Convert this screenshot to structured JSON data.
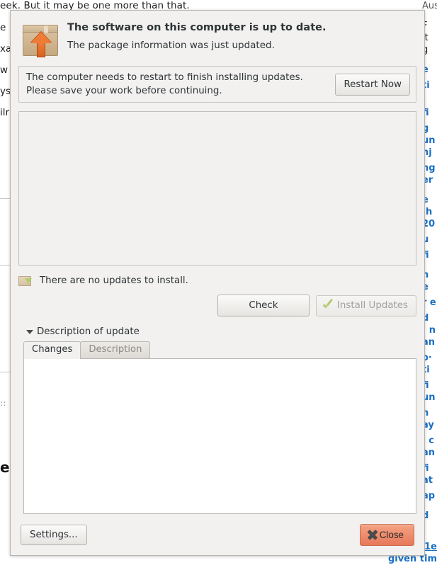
{
  "background": {
    "top_line": "eek. But it may be one more than that.",
    "left_fragments": [
      "e",
      "xa",
      "w",
      "ys",
      "ilr"
    ],
    "left_big_fragment": "e",
    "left_dots": "∷",
    "top_right_fragment": "Austin T",
    "right_fragments": [
      {
        "text": "F",
        "link": false
      },
      {
        "text": "it",
        "link": false
      },
      {
        "text": "g",
        "link": false
      },
      {
        "text": "e",
        "link": true
      },
      {
        "text": "ti",
        "link": true
      },
      {
        "text": "·",
        "link": false
      },
      {
        "text": "fi",
        "link": true
      },
      {
        "text": "g",
        "link": true
      },
      {
        "text": "un",
        "link": true
      },
      {
        "text": "nj",
        "link": true
      },
      {
        "text": "ng",
        "link": true
      },
      {
        "text": "er",
        "link": true
      },
      {
        "text": "e",
        "link": true
      },
      {
        "text": "·h",
        "link": true
      },
      {
        "text": "20",
        "link": true
      },
      {
        "text": "u",
        "link": true
      },
      {
        "text": "fi",
        "link": true
      },
      {
        "text": "n",
        "link": true
      },
      {
        "text": "e",
        "link": true
      },
      {
        "text": "r e",
        "link": true
      },
      {
        "text": "d",
        "link": true
      },
      {
        "text": ": n",
        "link": true
      },
      {
        "text": "an",
        "link": true
      },
      {
        "text": "o·",
        "link": true
      },
      {
        "text": "ti",
        "link": true
      },
      {
        "text": "fi",
        "link": true
      },
      {
        "text": "un",
        "link": true
      },
      {
        "text": "n",
        "link": true
      },
      {
        "text": "ay",
        "link": true
      },
      {
        "text": "| c",
        "link": true
      },
      {
        "text": "an",
        "link": true
      },
      {
        "text": "fi",
        "link": true
      },
      {
        "text": "at",
        "link": true
      },
      {
        "text": "ap",
        "link": true
      },
      {
        "text": "d",
        "link": true
      }
    ],
    "bottom_right_link": "1e",
    "bottom_right_text": "given tim"
  },
  "dialog": {
    "header": {
      "title": "The software on this computer is up to date.",
      "subtitle": "The package information was just updated.",
      "icon": "package-update-icon"
    },
    "restart_notice": {
      "message": "The computer needs to restart to finish installing updates. Please save your work before continuing.",
      "button_label": "Restart Now"
    },
    "updates_list": {
      "items": []
    },
    "status": {
      "icon": "package-download-icon",
      "text": "There are no updates to install."
    },
    "actions": {
      "check_label": "Check",
      "install_label": "Install Updates",
      "install_icon": "check-mark-icon",
      "install_enabled": false
    },
    "expander": {
      "label": "Description of update",
      "expanded": true
    },
    "tabs": [
      {
        "label": "Changes",
        "active": true
      },
      {
        "label": "Description",
        "active": false
      }
    ],
    "tab_content": "",
    "footer": {
      "settings_label": "Settings...",
      "close_label": "Close",
      "close_icon": "close-x-icon"
    }
  },
  "colors": {
    "dialog_bg": "#f2f1f0",
    "close_button": "#e7785a",
    "accent_orange": "#ef7c36",
    "check_green": "#b2cc70",
    "link_blue": "#1a6fc4"
  }
}
